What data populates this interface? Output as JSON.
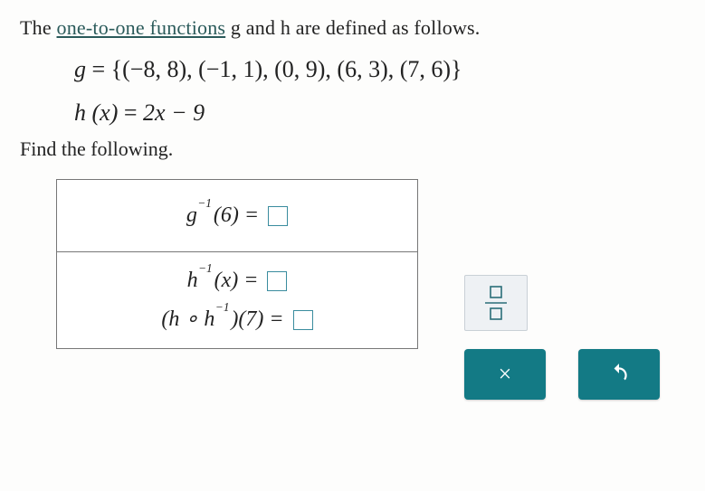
{
  "prompt": {
    "prefix": "The ",
    "underlined": "one-to-one functions",
    "suffix": " g and h are defined as follows."
  },
  "definitions": {
    "g_lhs": "g",
    "g_rhs": "{(−8, 8), (−1, 1), (0, 9), (6, 3), (7, 6)}",
    "h_lhs": "h (x)",
    "h_rhs": "2x − 9"
  },
  "find_text": "Find the following.",
  "rows": {
    "r1": {
      "base": "g",
      "exp": "−1",
      "arg": "(6)",
      "eq": " = "
    },
    "r2": {
      "base": "h",
      "exp": "−1",
      "arg": "(x)",
      "eq": " = "
    },
    "r3": {
      "open": "(",
      "b1": "h",
      "comp": " ∘ ",
      "b2": "h",
      "exp": "−1",
      "close": ")",
      "arg": "(7)",
      "eq": " = "
    }
  },
  "buttons": {
    "fraction": "fraction",
    "cancel": "×",
    "reset": "↺"
  },
  "colors": {
    "accent": "#137a85",
    "box": "#3a8c9e"
  }
}
